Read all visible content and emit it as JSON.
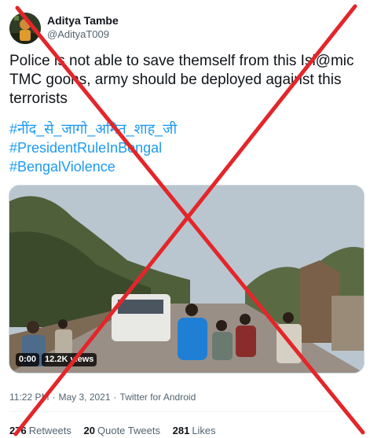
{
  "user": {
    "display_name": "Aditya Tambe",
    "handle": "@AdityaT009"
  },
  "tweet": {
    "text": "Police is not able to save themself from this Isl@mic TMC goons, army should be deployed against this terrorists",
    "hashtags": [
      "#नींद_से_जागो_अमित_शाह_जी",
      "#PresidentRuleInBengal",
      "#BengalViolence"
    ]
  },
  "media": {
    "time": "0:00",
    "views": "12.2K views"
  },
  "meta": {
    "time": "11:22 PM",
    "date": "May 3, 2021",
    "source": "Twitter for Android",
    "separator": "·"
  },
  "stats": {
    "retweets_count": "276",
    "retweets_label": "Retweets",
    "quotes_count": "20",
    "quotes_label": "Quote Tweets",
    "likes_count": "281",
    "likes_label": "Likes"
  },
  "colors": {
    "link": "#1d9bf0",
    "cross": "#e3262a"
  }
}
